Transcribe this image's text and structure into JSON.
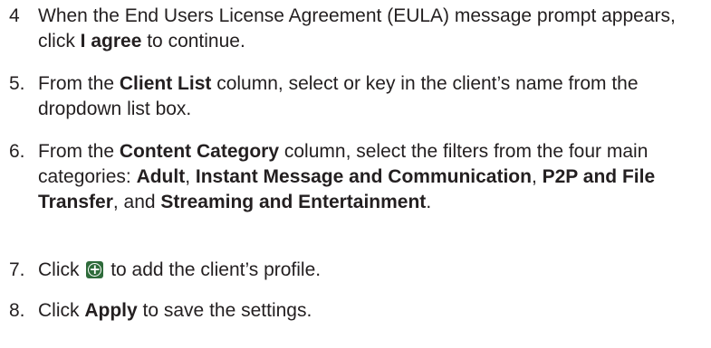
{
  "steps": [
    {
      "number": "4",
      "parts": [
        "When the End Users License Agreement (EULA) message prompt appears, click ",
        "I agree",
        " to continue."
      ]
    },
    {
      "number": "5.",
      "parts": [
        "From the ",
        "Client List",
        " column, select or key in the client’s name from the dropdown list box."
      ]
    },
    {
      "number": "6.",
      "parts": [
        "From the ",
        "Content Category",
        " column, select the filters from the four main categories: ",
        "Adult",
        ", ",
        "Instant Message and Communication",
        ", ",
        "P2P and File Transfer",
        ", and ",
        "Streaming and Entertainment",
        "."
      ]
    },
    {
      "number": "7.",
      "parts": [
        "Click",
        "to add the client’s profile."
      ],
      "icon": "add-circle-icon",
      "icon_color": "#2e6b3a"
    },
    {
      "number": "8.",
      "parts": [
        "Click ",
        "Apply",
        " to save the settings."
      ]
    }
  ]
}
